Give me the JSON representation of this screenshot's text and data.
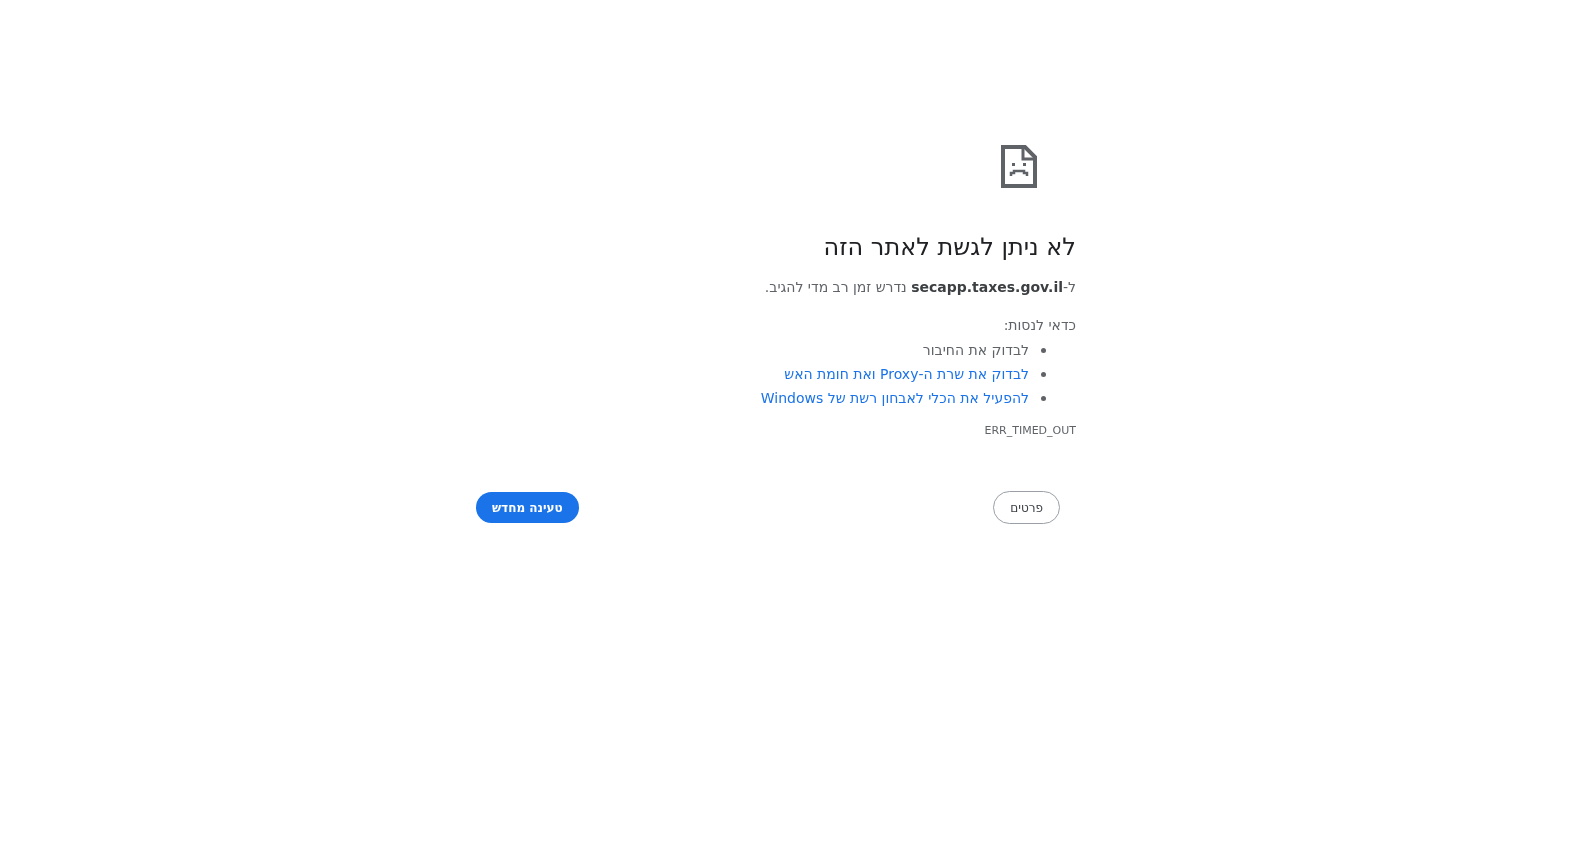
{
  "title": "לא ניתן לגשת לאתר הזה",
  "message": "ל-**secapp.taxes.gov.il** נדרש זמן רב מדי להגיב.",
  "suggestions_heading": "כדאי לנסות:",
  "suggestions": [
    {
      "kind": "text",
      "label": "לבדוק את החיבור"
    },
    {
      "kind": "link",
      "label": "לבדוק את שרת ה-Proxy ואת חומת האש"
    },
    {
      "kind": "link",
      "label": "להפעיל את הכלי לאבחון רשת של Windows"
    }
  ],
  "error_code": "ERR_TIMED_OUT",
  "buttons": {
    "details": "פרטים",
    "reload": "טעינה מחדש"
  }
}
